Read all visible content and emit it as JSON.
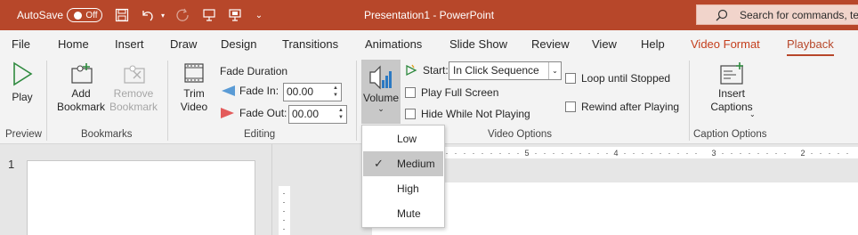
{
  "titlebar": {
    "autosave_label": "AutoSave",
    "autosave_state": "Off",
    "document_title": "Presentation1  -  PowerPoint",
    "search_placeholder": "Search for commands, te"
  },
  "tabs": [
    {
      "label": "File"
    },
    {
      "label": "Home"
    },
    {
      "label": "Insert"
    },
    {
      "label": "Draw"
    },
    {
      "label": "Design"
    },
    {
      "label": "Transitions"
    },
    {
      "label": "Animations"
    },
    {
      "label": "Slide Show"
    },
    {
      "label": "Review"
    },
    {
      "label": "View"
    },
    {
      "label": "Help"
    },
    {
      "label": "Video Format"
    },
    {
      "label": "Playback"
    }
  ],
  "ribbon": {
    "preview": {
      "play": "Play",
      "group": "Preview"
    },
    "bookmarks": {
      "add": [
        "Add",
        "Bookmark"
      ],
      "remove": [
        "Remove",
        "Bookmark"
      ],
      "group": "Bookmarks"
    },
    "editing": {
      "trim": [
        "Trim",
        "Video"
      ],
      "fade_duration": "Fade Duration",
      "fade_in_label": "Fade In:",
      "fade_in_value": "00.00",
      "fade_out_label": "Fade Out:",
      "fade_out_value": "00.00",
      "group": "Editing"
    },
    "video_options": {
      "volume": "Volume",
      "start_label": "Start:",
      "start_value": "In Click Sequence",
      "play_full_screen": "Play Full Screen",
      "hide_while_not_playing": "Hide While Not Playing",
      "loop_until_stopped": "Loop until Stopped",
      "rewind_after_playing": "Rewind after Playing",
      "group": "Video Options"
    },
    "captions": {
      "insert": [
        "Insert",
        "Captions"
      ],
      "group": "Caption Options"
    }
  },
  "volume_menu": [
    {
      "label": "Low",
      "selected": false
    },
    {
      "label": "Medium",
      "selected": true
    },
    {
      "label": "High",
      "selected": false
    },
    {
      "label": "Mute",
      "selected": false
    }
  ],
  "slides": {
    "number": "1"
  },
  "ruler": {
    "labels": [
      "5",
      "4",
      "3",
      "2"
    ]
  },
  "colors": {
    "brand": "#b7472a",
    "accent_tab": "#c43e1c"
  }
}
